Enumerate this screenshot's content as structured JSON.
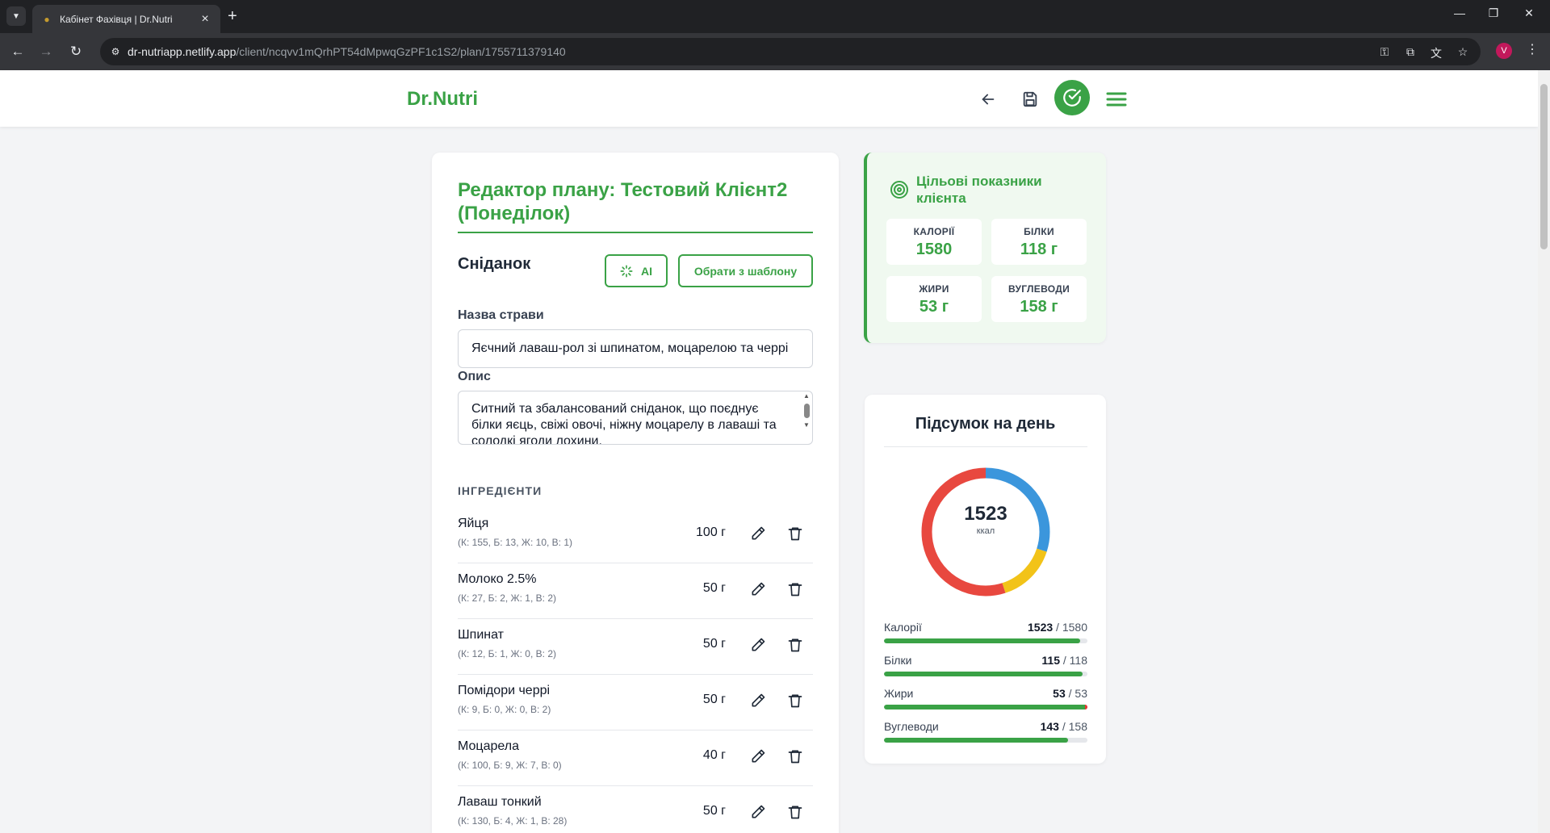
{
  "browser": {
    "tab_title": "Кабінет Фахівця | Dr.Nutri",
    "url_host": "dr-nutriapp.netlify.app",
    "url_path": "/client/ncqvv1mQrhPT54dMpwqGzPF1c1S2/plan/1755711379140",
    "profile_initial": "V"
  },
  "header": {
    "logo": "Dr.Nutri",
    "accent": "#3aa246"
  },
  "editor": {
    "title": "Редактор плану: Тестовий Клієнт2 (Понеділок)",
    "meal_title": "Сніданок",
    "ai_button": "AI",
    "template_button": "Обрати з шаблону",
    "dish_name_label": "Назва страви",
    "dish_name_value": "Яєчний лаваш-рол зі шпинатом, моцарелою та черрі",
    "description_label": "Опис",
    "description_value": "Ситний та збалансований сніданок, що поєднує білки яєць, свіжі овочі, ніжну моцарелу в лаваші та солодкі ягоди лохини.",
    "ingredients_label": "ІНГРЕДІЄНТИ",
    "ingredients": [
      {
        "name": "Яйця",
        "macros": "(К: 155, Б: 13, Ж: 10, В: 1)",
        "qty": "100 г"
      },
      {
        "name": "Молоко 2.5%",
        "macros": "(К: 27, Б: 2, Ж: 1, В: 2)",
        "qty": "50 г"
      },
      {
        "name": "Шпинат",
        "macros": "(К: 12, Б: 1, Ж: 0, В: 2)",
        "qty": "50 г"
      },
      {
        "name": "Помідори черрі",
        "macros": "(К: 9, Б: 0, Ж: 0, В: 2)",
        "qty": "50 г"
      },
      {
        "name": "Моцарела",
        "macros": "(К: 100, Б: 9, Ж: 7, В: 0)",
        "qty": "40 г"
      },
      {
        "name": "Лаваш тонкий",
        "macros": "(К: 130, Б: 4, Ж: 1, В: 28)",
        "qty": "50 г"
      }
    ]
  },
  "targets": {
    "title": "Цільові показники клієнта",
    "calories_label": "КАЛОРІЇ",
    "calories_value": "1580",
    "protein_label": "БІЛКИ",
    "protein_value": "118 г",
    "fat_label": "ЖИРИ",
    "fat_value": "53 г",
    "carbs_label": "ВУГЛЕВОДИ",
    "carbs_value": "158 г"
  },
  "summary": {
    "title": "Підсумок на день",
    "total_kcal": "1523",
    "kcal_unit": "ккал",
    "donut_segments": [
      {
        "macro": "protein",
        "fraction": 0.3,
        "color": "#3b96dc"
      },
      {
        "macro": "fat",
        "fraction": 0.15,
        "color": "#f2c318"
      },
      {
        "macro": "carbs",
        "fraction": 0.55,
        "color": "#e8483f"
      }
    ],
    "bars": [
      {
        "label": "Калорії",
        "current": "1523",
        "target": "1580",
        "fraction": 0.964,
        "over": false
      },
      {
        "label": "Білки",
        "current": "115",
        "target": "118",
        "fraction": 0.975,
        "over": false
      },
      {
        "label": "Жири",
        "current": "53",
        "target": "53",
        "fraction": 1.0,
        "over": true
      },
      {
        "label": "Вуглеводи",
        "current": "143",
        "target": "158",
        "fraction": 0.905,
        "over": false
      }
    ]
  }
}
